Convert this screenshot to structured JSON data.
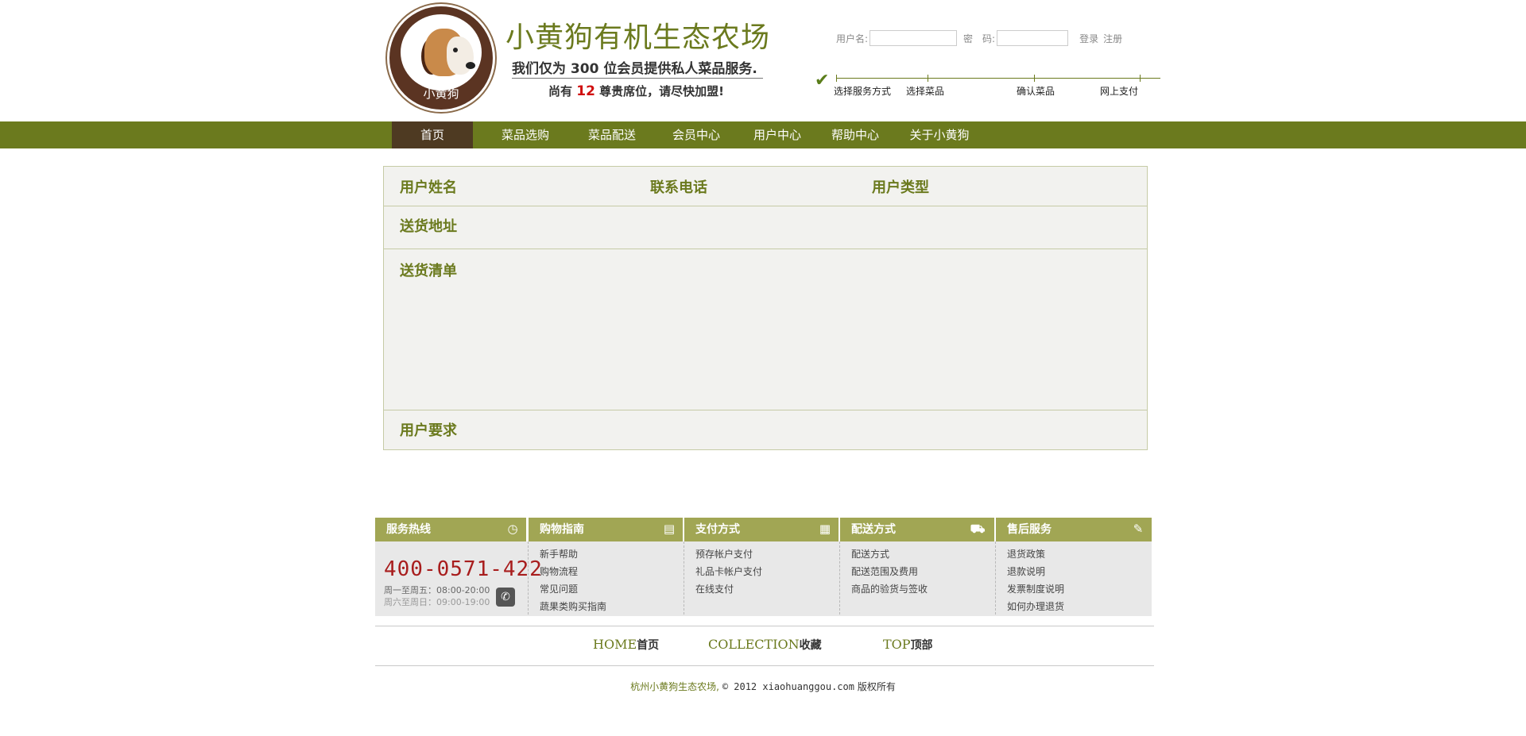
{
  "header": {
    "logo_text": "小黄狗",
    "site_title": "小黄狗有机生态农场",
    "slogan": "我们仅为 300 位会员提供私人菜品服务.",
    "seats_prefix": "尚有",
    "seats_count": "12",
    "seats_suffix": "尊贵席位，请尽快加盟!"
  },
  "login": {
    "username_label": "用户名:",
    "username_value": "",
    "password_label": "密　码:",
    "password_value": "",
    "login_link": "登录",
    "register_link": "注册"
  },
  "steps": [
    "选择服务方式",
    "选择菜品",
    "确认菜品",
    "网上支付"
  ],
  "nav": {
    "items": [
      "首页",
      "菜品选购",
      "菜品配送",
      "会员中心",
      "用户中心",
      "帮助中心",
      "关于小黄狗"
    ],
    "active_index": 0
  },
  "form": {
    "user_name": "用户姓名",
    "phone": "联系电话",
    "user_type": "用户类型",
    "address": "送货地址",
    "delivery_list": "送货清单",
    "requirements": "用户要求"
  },
  "footer": {
    "columns": [
      {
        "title": "服务热线",
        "icon": "clock-icon"
      },
      {
        "title": "购物指南",
        "icon": "book-icon",
        "links": [
          "新手帮助",
          "购物流程",
          "常见问题",
          "蔬果类购买指南"
        ]
      },
      {
        "title": "支付方式",
        "icon": "calendar-icon",
        "links": [
          "预存帐户支付",
          "礼品卡帐户支付",
          "在线支付"
        ]
      },
      {
        "title": "配送方式",
        "icon": "truck-icon",
        "links": [
          "配送方式",
          "配送范围及费用",
          "商品的验货与签收"
        ]
      },
      {
        "title": "售后服务",
        "icon": "service-icon",
        "links": [
          "退货政策",
          "退款说明",
          "发票制度说明",
          "如何办理退货"
        ]
      }
    ],
    "hotline": "400-0571-422",
    "hours_weekday": "周一至周五：08:00-20:00",
    "hours_weekend": "周六至周日：09:00-19:00",
    "bottom_links": [
      {
        "en": "HOME",
        "cn": "首页"
      },
      {
        "en": "COLLECTION",
        "cn": "收藏"
      },
      {
        "en": "TOP",
        "cn": "顶部"
      }
    ],
    "copyright_company": "杭州小黄狗生态农场,",
    "copyright_text": "© 2012 xiaohuanggou.com",
    "copyright_rights": "版权所有"
  },
  "colors": {
    "brand_green": "#6b7a1e",
    "nav_active": "#4e3a22",
    "footer_header": "#a1a654",
    "hotline_red": "#a81d1d"
  }
}
